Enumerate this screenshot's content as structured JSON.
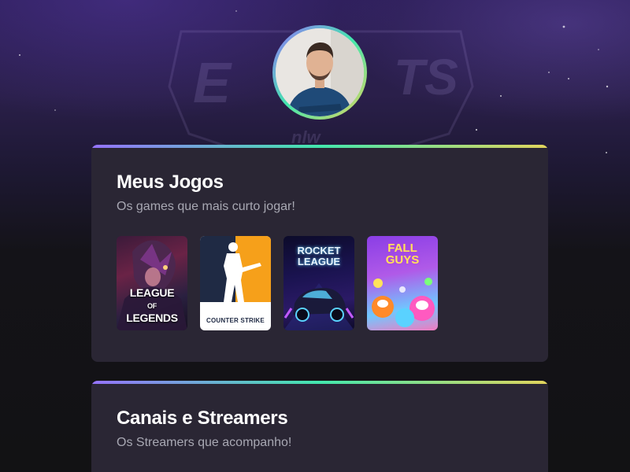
{
  "profile": {
    "avatar_alt": "Foto de perfil"
  },
  "games_section": {
    "title": "Meus Jogos",
    "subtitle": "Os games que mais curto jogar!",
    "games": [
      {
        "name": "League of Legends",
        "label_top": "LEAGUE",
        "label_of": "OF",
        "label_bottom": "LEGENDS"
      },
      {
        "name": "Counter-Strike",
        "label": "COUNTER STRIKE"
      },
      {
        "name": "Rocket League",
        "label_top": "ROCKET",
        "label_bottom": "LEAGUE"
      },
      {
        "name": "Fall Guys",
        "label_top": "FALL",
        "label_bottom": "GUYS"
      }
    ]
  },
  "streamers_section": {
    "title": "Canais e Streamers",
    "subtitle": "Os Streamers que acompanho!"
  },
  "colors": {
    "card_bg": "#2a2634",
    "gradient_start": "#9572fc",
    "gradient_mid": "#43e7ad",
    "gradient_end": "#e2d45c",
    "text_primary": "#ffffff",
    "text_secondary": "#a8a8b3"
  }
}
